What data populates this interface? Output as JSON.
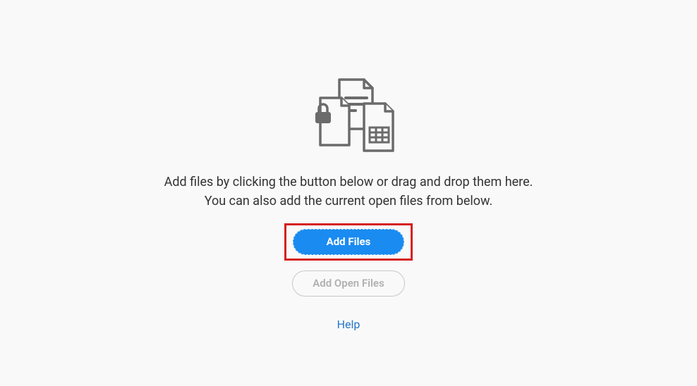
{
  "description": {
    "line1": "Add files by clicking the button below or drag and drop them here.",
    "line2": "You can also add the current open files from below."
  },
  "buttons": {
    "add_files": "Add Files",
    "add_open_files": "Add Open Files"
  },
  "help_link": "Help"
}
